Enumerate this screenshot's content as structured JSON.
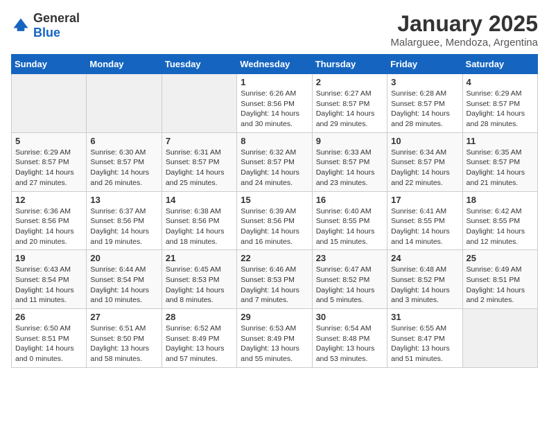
{
  "logo": {
    "general": "General",
    "blue": "Blue"
  },
  "header": {
    "month": "January 2025",
    "location": "Malarguee, Mendoza, Argentina"
  },
  "weekdays": [
    "Sunday",
    "Monday",
    "Tuesday",
    "Wednesday",
    "Thursday",
    "Friday",
    "Saturday"
  ],
  "weeks": [
    [
      {
        "day": "",
        "sunrise": "",
        "sunset": "",
        "daylight": ""
      },
      {
        "day": "",
        "sunrise": "",
        "sunset": "",
        "daylight": ""
      },
      {
        "day": "",
        "sunrise": "",
        "sunset": "",
        "daylight": ""
      },
      {
        "day": "1",
        "sunrise": "Sunrise: 6:26 AM",
        "sunset": "Sunset: 8:56 PM",
        "daylight": "Daylight: 14 hours and 30 minutes."
      },
      {
        "day": "2",
        "sunrise": "Sunrise: 6:27 AM",
        "sunset": "Sunset: 8:57 PM",
        "daylight": "Daylight: 14 hours and 29 minutes."
      },
      {
        "day": "3",
        "sunrise": "Sunrise: 6:28 AM",
        "sunset": "Sunset: 8:57 PM",
        "daylight": "Daylight: 14 hours and 28 minutes."
      },
      {
        "day": "4",
        "sunrise": "Sunrise: 6:29 AM",
        "sunset": "Sunset: 8:57 PM",
        "daylight": "Daylight: 14 hours and 28 minutes."
      }
    ],
    [
      {
        "day": "5",
        "sunrise": "Sunrise: 6:29 AM",
        "sunset": "Sunset: 8:57 PM",
        "daylight": "Daylight: 14 hours and 27 minutes."
      },
      {
        "day": "6",
        "sunrise": "Sunrise: 6:30 AM",
        "sunset": "Sunset: 8:57 PM",
        "daylight": "Daylight: 14 hours and 26 minutes."
      },
      {
        "day": "7",
        "sunrise": "Sunrise: 6:31 AM",
        "sunset": "Sunset: 8:57 PM",
        "daylight": "Daylight: 14 hours and 25 minutes."
      },
      {
        "day": "8",
        "sunrise": "Sunrise: 6:32 AM",
        "sunset": "Sunset: 8:57 PM",
        "daylight": "Daylight: 14 hours and 24 minutes."
      },
      {
        "day": "9",
        "sunrise": "Sunrise: 6:33 AM",
        "sunset": "Sunset: 8:57 PM",
        "daylight": "Daylight: 14 hours and 23 minutes."
      },
      {
        "day": "10",
        "sunrise": "Sunrise: 6:34 AM",
        "sunset": "Sunset: 8:57 PM",
        "daylight": "Daylight: 14 hours and 22 minutes."
      },
      {
        "day": "11",
        "sunrise": "Sunrise: 6:35 AM",
        "sunset": "Sunset: 8:57 PM",
        "daylight": "Daylight: 14 hours and 21 minutes."
      }
    ],
    [
      {
        "day": "12",
        "sunrise": "Sunrise: 6:36 AM",
        "sunset": "Sunset: 8:56 PM",
        "daylight": "Daylight: 14 hours and 20 minutes."
      },
      {
        "day": "13",
        "sunrise": "Sunrise: 6:37 AM",
        "sunset": "Sunset: 8:56 PM",
        "daylight": "Daylight: 14 hours and 19 minutes."
      },
      {
        "day": "14",
        "sunrise": "Sunrise: 6:38 AM",
        "sunset": "Sunset: 8:56 PM",
        "daylight": "Daylight: 14 hours and 18 minutes."
      },
      {
        "day": "15",
        "sunrise": "Sunrise: 6:39 AM",
        "sunset": "Sunset: 8:56 PM",
        "daylight": "Daylight: 14 hours and 16 minutes."
      },
      {
        "day": "16",
        "sunrise": "Sunrise: 6:40 AM",
        "sunset": "Sunset: 8:55 PM",
        "daylight": "Daylight: 14 hours and 15 minutes."
      },
      {
        "day": "17",
        "sunrise": "Sunrise: 6:41 AM",
        "sunset": "Sunset: 8:55 PM",
        "daylight": "Daylight: 14 hours and 14 minutes."
      },
      {
        "day": "18",
        "sunrise": "Sunrise: 6:42 AM",
        "sunset": "Sunset: 8:55 PM",
        "daylight": "Daylight: 14 hours and 12 minutes."
      }
    ],
    [
      {
        "day": "19",
        "sunrise": "Sunrise: 6:43 AM",
        "sunset": "Sunset: 8:54 PM",
        "daylight": "Daylight: 14 hours and 11 minutes."
      },
      {
        "day": "20",
        "sunrise": "Sunrise: 6:44 AM",
        "sunset": "Sunset: 8:54 PM",
        "daylight": "Daylight: 14 hours and 10 minutes."
      },
      {
        "day": "21",
        "sunrise": "Sunrise: 6:45 AM",
        "sunset": "Sunset: 8:53 PM",
        "daylight": "Daylight: 14 hours and 8 minutes."
      },
      {
        "day": "22",
        "sunrise": "Sunrise: 6:46 AM",
        "sunset": "Sunset: 8:53 PM",
        "daylight": "Daylight: 14 hours and 7 minutes."
      },
      {
        "day": "23",
        "sunrise": "Sunrise: 6:47 AM",
        "sunset": "Sunset: 8:52 PM",
        "daylight": "Daylight: 14 hours and 5 minutes."
      },
      {
        "day": "24",
        "sunrise": "Sunrise: 6:48 AM",
        "sunset": "Sunset: 8:52 PM",
        "daylight": "Daylight: 14 hours and 3 minutes."
      },
      {
        "day": "25",
        "sunrise": "Sunrise: 6:49 AM",
        "sunset": "Sunset: 8:51 PM",
        "daylight": "Daylight: 14 hours and 2 minutes."
      }
    ],
    [
      {
        "day": "26",
        "sunrise": "Sunrise: 6:50 AM",
        "sunset": "Sunset: 8:51 PM",
        "daylight": "Daylight: 14 hours and 0 minutes."
      },
      {
        "day": "27",
        "sunrise": "Sunrise: 6:51 AM",
        "sunset": "Sunset: 8:50 PM",
        "daylight": "Daylight: 13 hours and 58 minutes."
      },
      {
        "day": "28",
        "sunrise": "Sunrise: 6:52 AM",
        "sunset": "Sunset: 8:49 PM",
        "daylight": "Daylight: 13 hours and 57 minutes."
      },
      {
        "day": "29",
        "sunrise": "Sunrise: 6:53 AM",
        "sunset": "Sunset: 8:49 PM",
        "daylight": "Daylight: 13 hours and 55 minutes."
      },
      {
        "day": "30",
        "sunrise": "Sunrise: 6:54 AM",
        "sunset": "Sunset: 8:48 PM",
        "daylight": "Daylight: 13 hours and 53 minutes."
      },
      {
        "day": "31",
        "sunrise": "Sunrise: 6:55 AM",
        "sunset": "Sunset: 8:47 PM",
        "daylight": "Daylight: 13 hours and 51 minutes."
      },
      {
        "day": "",
        "sunrise": "",
        "sunset": "",
        "daylight": ""
      }
    ]
  ]
}
